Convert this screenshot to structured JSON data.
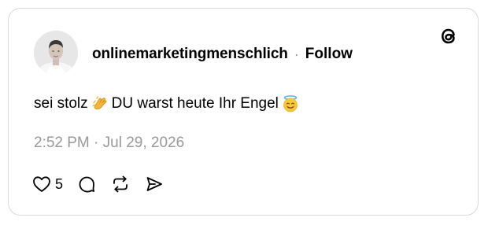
{
  "post": {
    "username": "onlinemarketingmenschlich",
    "separator": "·",
    "follow_label": "Follow",
    "text_part1": "sei stolz",
    "text_part2": "DU warst heute Ihr Engel",
    "emoji_1": "clapping-hands",
    "emoji_2": "smiling-face-with-halo",
    "timestamp": "2:52 PM · Jul 29, 2026",
    "likes": "5"
  },
  "icons": {
    "logo": "threads-logo",
    "like": "heart-icon",
    "reply": "comment-icon",
    "repost": "repost-icon",
    "share": "send-icon"
  },
  "colors": {
    "text": "#000000",
    "muted": "#999999",
    "border": "#d9d9d9",
    "background": "#ffffff"
  }
}
